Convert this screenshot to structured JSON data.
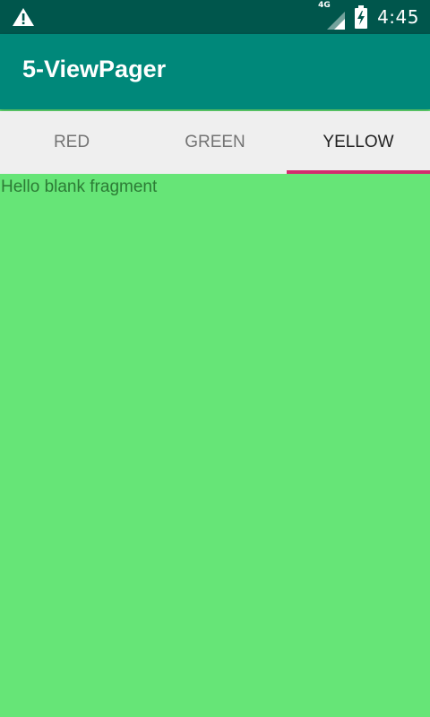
{
  "status_bar": {
    "network_label": "4G",
    "time": "4:45",
    "icons": [
      "warning-icon",
      "signal-icon",
      "battery-charging-icon"
    ]
  },
  "app_bar": {
    "title": "5-ViewPager"
  },
  "tabs": [
    {
      "label": "RED",
      "selected": false
    },
    {
      "label": "GREEN",
      "selected": false
    },
    {
      "label": "YELLOW",
      "selected": true
    }
  ],
  "fragment": {
    "text": "Hello blank fragment"
  },
  "colors": {
    "status_bar": "#00564c",
    "app_bar": "#00887a",
    "tab_bar": "#efefef",
    "tab_indicator": "#d22c6e",
    "content_background": "#66e577",
    "fragment_text": "#2c7b35"
  }
}
